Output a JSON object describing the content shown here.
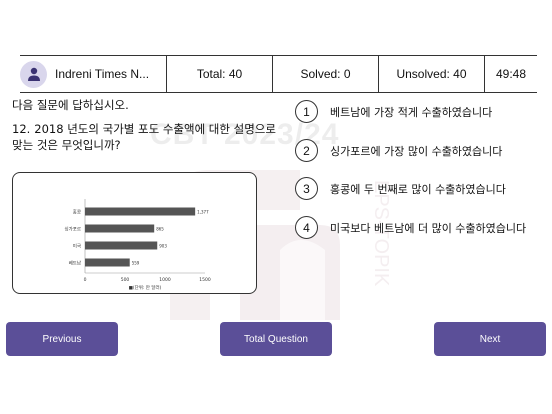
{
  "watermark": {
    "text": "CBT 2023/24",
    "logo_text": "EPS-TOPIK"
  },
  "header": {
    "title": "Indreni Times N...",
    "total": "Total: 40",
    "solved": "Solved: 0",
    "unsolved": "Unsolved: 40",
    "timer": "49:48",
    "avatar_icon": "user-icon"
  },
  "instruction": "다음 질문에 답하십시오.",
  "question": {
    "number": "12.",
    "text": "2018 년도의 국가별 포도 수출액에 대한 설명으로 맞는 것은 무엇입니까?"
  },
  "chart_data": {
    "type": "bar",
    "orientation": "horizontal",
    "categories": [
      "홍콩",
      "싱가포르",
      "미국",
      "베트남"
    ],
    "values": [
      1377,
      865,
      903,
      559
    ],
    "xlim": [
      0,
      1500
    ],
    "xticks": [
      "0",
      "500",
      "1000",
      "1500"
    ],
    "xlabel": "■(단위: 만 달러)",
    "bar_color": "#555555",
    "grid": false
  },
  "options": [
    {
      "num": "1",
      "text": "베트남에 가장 적게 수출하였습니다"
    },
    {
      "num": "2",
      "text": "싱가포르에 가장 많이 수출하였습니다"
    },
    {
      "num": "3",
      "text": "홍콩에 두 번째로 많이 수출하였습니다"
    },
    {
      "num": "4",
      "text": "미국보다 베트남에 더 많이 수출하였습니다"
    }
  ],
  "buttons": {
    "previous": "Previous",
    "total_question": "Total Question",
    "next": "Next"
  },
  "colors": {
    "accent": "#5b4f98",
    "avatar_bg": "#d9d6ec"
  }
}
